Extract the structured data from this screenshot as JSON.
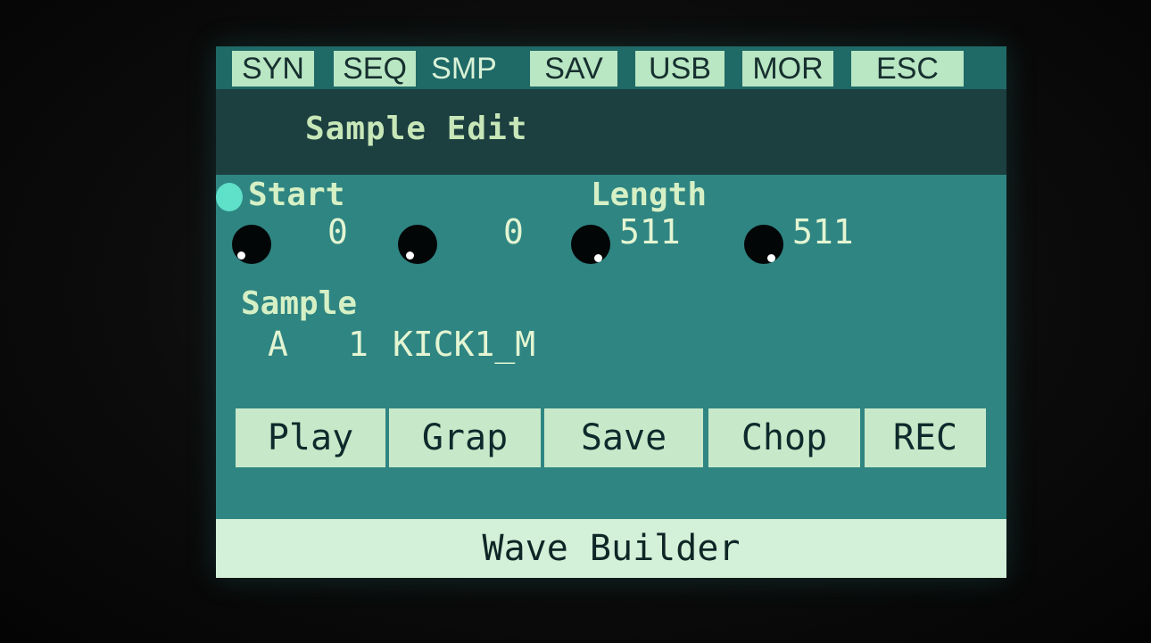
{
  "tabs": {
    "syn": "SYN",
    "seq": "SEQ",
    "smp": "SMP",
    "sav": "SAV",
    "usb": "USB",
    "mor": "MOR",
    "esc": "ESC"
  },
  "page_title": "Sample Edit",
  "params": {
    "start_label": "Start",
    "length_label": "Length",
    "values": [
      "0",
      "0",
      "511",
      "511"
    ]
  },
  "sample": {
    "label": "Sample",
    "bank": "A",
    "number": "1",
    "name": "KICK1_M"
  },
  "buttons": {
    "play": "Play",
    "graph": "Grap",
    "save": "Save",
    "chop": "Chop",
    "rec": "REC"
  },
  "footer": "Wave Builder",
  "colors": {
    "screen_bg": "#2f8582",
    "title_bg": "#1c3f40",
    "highlight": "#b9e6c3",
    "selector": "#5fe0c8"
  }
}
